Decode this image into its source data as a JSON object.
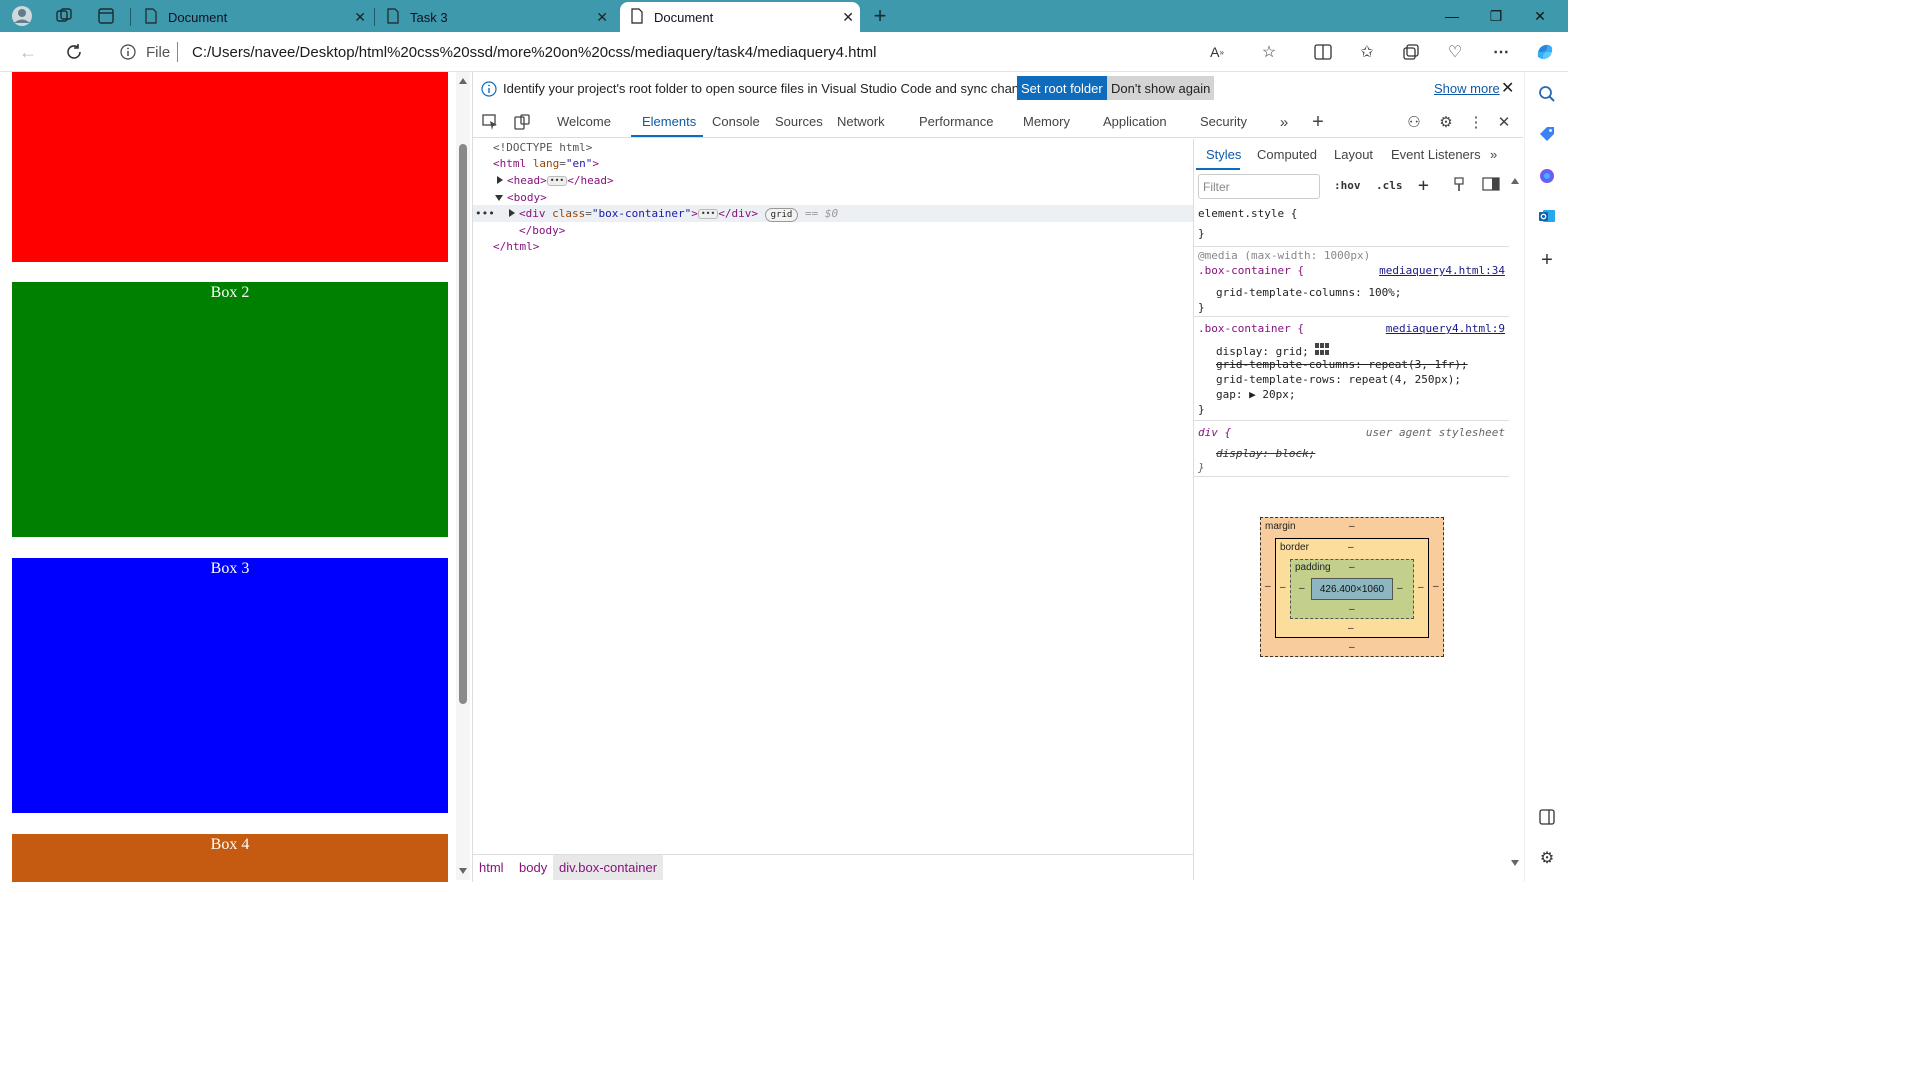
{
  "tabs": [
    {
      "title": "Document",
      "active": false
    },
    {
      "title": "Task 3",
      "active": false
    },
    {
      "title": "Document",
      "active": true
    }
  ],
  "address": {
    "file_label": "File",
    "url": "C:/Users/navee/Desktop/html%20css%20ssd/more%20on%20css/mediaquery/task4/mediaquery4.html"
  },
  "page": {
    "boxes": [
      {
        "label": "",
        "color": "#ff0000"
      },
      {
        "label": "Box 2",
        "color": "#008000"
      },
      {
        "label": "Box 3",
        "color": "#0000ff"
      },
      {
        "label": "Box 4",
        "color": "#c55a11"
      }
    ]
  },
  "infobar": {
    "text": "Identify your project's root folder to open source files in Visual Studio Code and sync changes.",
    "set_root": "Set root folder",
    "dont_show": "Don't show again",
    "show_more": "Show more"
  },
  "devtools_tabs": [
    "Welcome",
    "Elements",
    "Console",
    "Sources",
    "Network",
    "Performance",
    "Memory",
    "Application",
    "Security"
  ],
  "dom": {
    "doctype": "<!DOCTYPE html>",
    "html_open": "<html",
    "lang_attr": "lang",
    "lang_val": "\"en\"",
    "head": "<head>",
    "head_close": "</head>",
    "body": "<body>",
    "div_open": "<div",
    "class_attr": "class",
    "class_val": "\"box-container\"",
    "div_close": "</div>",
    "grid_badge": "grid",
    "eq_ref": "== $0",
    "body_close": "</body>",
    "html_close": "</html>"
  },
  "breadcrumbs": [
    "html",
    "body",
    "div.box-container"
  ],
  "styles_tabs": [
    "Styles",
    "Computed",
    "Layout",
    "Event Listeners"
  ],
  "styles": {
    "filter_placeholder": "Filter",
    "hov": ":hov",
    "cls": ".cls",
    "element_style": "element.style {",
    "close_brace": "}",
    "media": "@media (max-width: 1000px)",
    "rule1_selector": ".box-container {",
    "rule1_source": "mediaquery4.html:34",
    "rule1_prop": "grid-template-columns: 100%;",
    "rule2_selector": ".box-container {",
    "rule2_source": "mediaquery4.html:9",
    "rule2_display": "display: grid;",
    "rule2_strike": "grid-template-columns: repeat(3, 1fr);",
    "rule2_rows": "grid-template-rows: repeat(4, 250px);",
    "rule2_gap": "gap: ▶ 20px;",
    "rule3_selector": "div {",
    "rule3_source": "user agent stylesheet",
    "rule3_prop": "display: block;"
  },
  "box_model": {
    "margin_label": "margin",
    "border_label": "border",
    "padding_label": "padding",
    "content": "426.400×1060",
    "dash": "–"
  }
}
